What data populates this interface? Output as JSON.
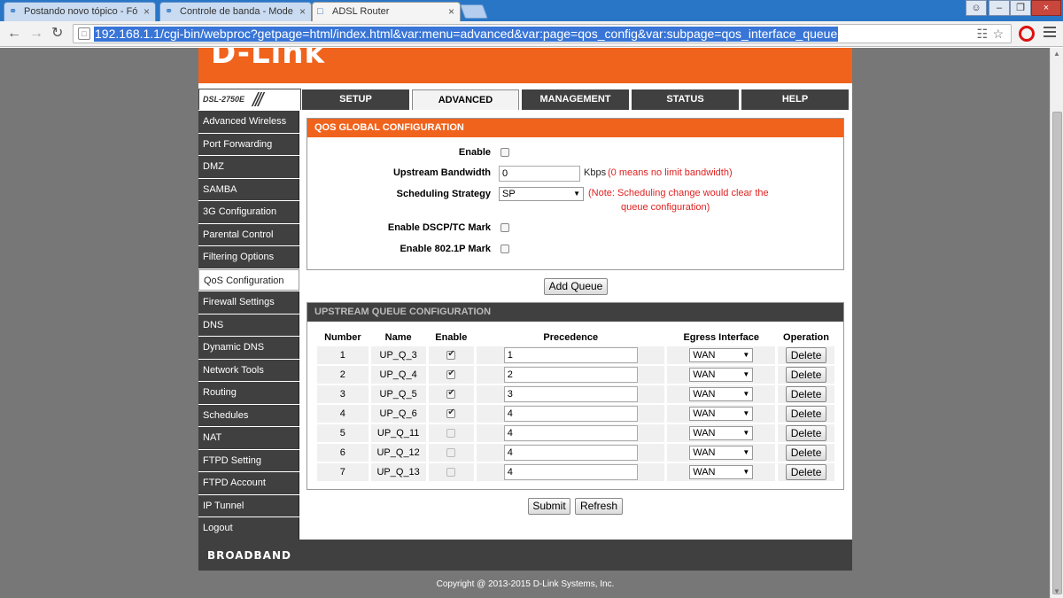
{
  "browser": {
    "tabs": [
      {
        "title": "Postando novo tópico - Fó",
        "active": false
      },
      {
        "title": "Controle de banda - Mode",
        "active": false
      },
      {
        "title": "ADSL Router",
        "active": true
      }
    ],
    "url": "192.168.1.1/cgi-bin/webproc?getpage=html/index.html&var:menu=advanced&var:page=qos_config&var:subpage=qos_interface_queue"
  },
  "router": {
    "logo": "D-Link",
    "model": "DSL-2750E",
    "nav": [
      "SETUP",
      "ADVANCED",
      "MANAGEMENT",
      "STATUS",
      "HELP"
    ],
    "active_nav": "ADVANCED",
    "sidebar": [
      "Advanced Wireless",
      "Port Forwarding",
      "DMZ",
      "SAMBA",
      "3G Configuration",
      "Parental Control",
      "Filtering Options",
      "QoS Configuration",
      "Firewall Settings",
      "DNS",
      "Dynamic DNS",
      "Network Tools",
      "Routing",
      "Schedules",
      "NAT",
      "FTPD Setting",
      "FTPD Account",
      "IP Tunnel",
      "Logout"
    ],
    "active_sidebar": "QoS Configuration"
  },
  "global_config": {
    "title": "QOS GLOBAL CONFIGURATION",
    "enable_label": "Enable",
    "enable_checked": false,
    "upstream_label": "Upstream Bandwidth",
    "upstream_value": "0",
    "upstream_unit": "Kbps",
    "upstream_note": "(0 means no limit bandwidth)",
    "strategy_label": "Scheduling Strategy",
    "strategy_value": "SP",
    "strategy_note_line1": "(Note: Scheduling change would clear the",
    "strategy_note_line2": "queue configuration)",
    "dscp_label": "Enable DSCP/TC Mark",
    "dscp_checked": false,
    "p8021_label": "Enable 802.1P Mark",
    "p8021_checked": false
  },
  "add_queue_label": "Add Queue",
  "queue_config": {
    "title": "UPSTREAM QUEUE CONFIGURATION",
    "headers": [
      "Number",
      "Name",
      "Enable",
      "Precedence",
      "Egress Interface",
      "Operation"
    ],
    "rows": [
      {
        "number": "1",
        "name": "UP_Q_3",
        "enabled": true,
        "precedence": "1",
        "egress": "WAN",
        "op": "Delete"
      },
      {
        "number": "2",
        "name": "UP_Q_4",
        "enabled": true,
        "precedence": "2",
        "egress": "WAN",
        "op": "Delete"
      },
      {
        "number": "3",
        "name": "UP_Q_5",
        "enabled": true,
        "precedence": "3",
        "egress": "WAN",
        "op": "Delete"
      },
      {
        "number": "4",
        "name": "UP_Q_6",
        "enabled": true,
        "precedence": "4",
        "egress": "WAN",
        "op": "Delete"
      },
      {
        "number": "5",
        "name": "UP_Q_11",
        "enabled": false,
        "precedence": "4",
        "egress": "WAN",
        "op": "Delete"
      },
      {
        "number": "6",
        "name": "UP_Q_12",
        "enabled": false,
        "precedence": "4",
        "egress": "WAN",
        "op": "Delete"
      },
      {
        "number": "7",
        "name": "UP_Q_13",
        "enabled": false,
        "precedence": "4",
        "egress": "WAN",
        "op": "Delete"
      }
    ]
  },
  "submit_label": "Submit",
  "refresh_label": "Refresh",
  "footer": {
    "brand": "BROADBAND",
    "copyright": "Copyright @ 2013-2015 D-Link Systems, Inc."
  }
}
